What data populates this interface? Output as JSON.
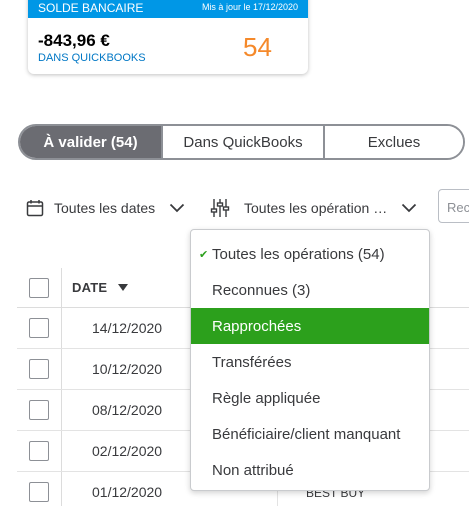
{
  "balance_card": {
    "title": "SOLDE BANCAIRE",
    "updated": "Mis à jour le 17/12/2020",
    "amount": "-843,96 €",
    "subtitle": "DANS QUICKBOOKS",
    "count": "54",
    "colors": {
      "header": "#0097e6",
      "count": "#f5892a",
      "subtitle": "#0077c5"
    }
  },
  "tabs": [
    {
      "label": "À valider (54)",
      "active": true
    },
    {
      "label": "Dans QuickBooks",
      "active": false
    },
    {
      "label": "Exclues",
      "active": false
    }
  ],
  "filters": {
    "dates": {
      "label": "Toutes les dates",
      "icon": "calendar-icon"
    },
    "operations": {
      "label": "Toutes les opération  …",
      "icon": "sliders-icon"
    },
    "search_placeholder": "Rec"
  },
  "table": {
    "headers": {
      "date": "DATE"
    },
    "rows": [
      {
        "date": "14/12/2020",
        "payee": ""
      },
      {
        "date": "10/12/2020",
        "payee": ""
      },
      {
        "date": "08/12/2020",
        "payee": ""
      },
      {
        "date": "02/12/2020",
        "payee": ""
      },
      {
        "date": "01/12/2020",
        "payee": "BEST BUY"
      }
    ]
  },
  "dropdown": {
    "items": [
      {
        "label": "Toutes les opérations (54)",
        "checked": true
      },
      {
        "label": "Reconnues (3)"
      },
      {
        "label": "Rapprochées",
        "highlighted": true
      },
      {
        "label": "Transférées"
      },
      {
        "label": "Règle appliquée"
      },
      {
        "label": "Bénéficiaire/client manquant"
      },
      {
        "label": "Non attribué"
      }
    ],
    "highlight_color": "#2ca01c"
  }
}
